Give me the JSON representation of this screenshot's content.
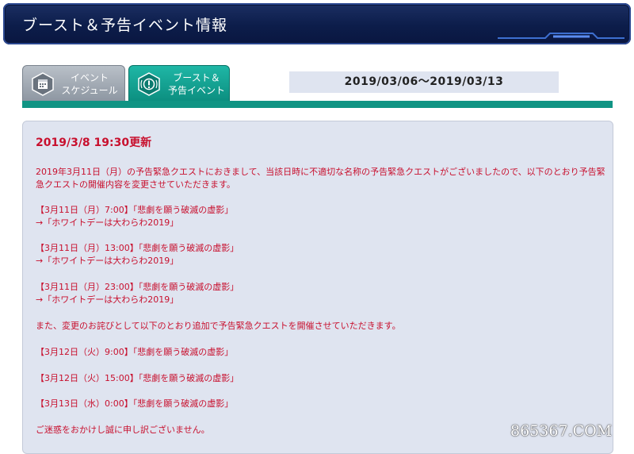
{
  "header": {
    "title": "ブースト＆予告イベント情報"
  },
  "tabs": [
    {
      "line1": "イベント",
      "line2": "スケジュール",
      "icon": "calendar-icon"
    },
    {
      "line1": "ブースト＆",
      "line2": "予告イベント",
      "icon": "alert-icon"
    }
  ],
  "date_range": "2019/03/06〜2019/03/13",
  "notice": {
    "update_title": "2019/3/8 19:30更新",
    "lines": [
      "2019年3月11日（月）の予告緊急クエストにおきまして、当該日時に不適切な名称の予告緊急クエストがございましたので、以下のとおり予告緊",
      "急クエストの開催内容を変更させていただきます。",
      "【3月11日（月）7:00】「悲劇を願う破滅の虚影」",
      "→「ホワイトデーは大わらわ2019」",
      "【3月11日（月）13:00】「悲劇を願う破滅の虚影」",
      "→「ホワイトデーは大わらわ2019」",
      "【3月11日（月）23:00】「悲劇を願う破滅の虚影」",
      "→「ホワイトデーは大わらわ2019」",
      "また、変更のお詫びとして以下のとおり追加で予告緊急クエストを開催させていただきます。",
      "【3月12日（火）9:00】「悲劇を願う破滅の虚影」",
      "【3月12日（火）15:00】「悲劇を願う破滅の虚影」",
      "【3月13日（水）0:00】「悲劇を願う破滅の虚影」",
      "ご迷惑をおかけし誠に申し訳ございません。"
    ]
  },
  "watermark": "865367.COM",
  "colors": {
    "header": "#0c1d4a",
    "accent": "#109484",
    "notice_text": "#c8102e",
    "panel": "#dfe4f0"
  }
}
